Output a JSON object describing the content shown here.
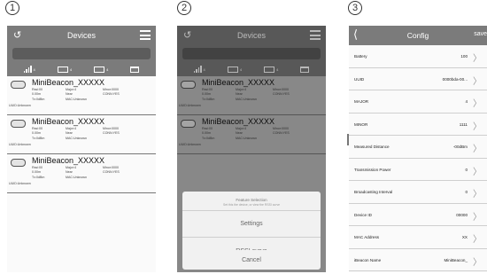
{
  "steps": [
    "1",
    "2",
    "3"
  ],
  "devices_screen": {
    "title": "Devices",
    "filters": [
      "4",
      "4",
      "4"
    ],
    "devices": [
      {
        "name": "MiniBeacon_XXXXX",
        "rssi": "Rssi:00",
        "distance": "0.00m",
        "tx": "Tx:0dBm",
        "major": "Major:4",
        "proximity": "Near",
        "mac": "MAC:Unknown",
        "minor": "Minor:0000",
        "conn": "CONN:YES",
        "uuid": "UUID:Unknown"
      },
      {
        "name": "MiniBeacon_XXXXX",
        "rssi": "Rssi:00",
        "distance": "0.00m",
        "tx": "Tx:0dBm",
        "major": "Major:4",
        "proximity": "Near",
        "mac": "MAC:Unknown",
        "minor": "Minor:0000",
        "conn": "CONN:YES",
        "uuid": "UUID:Unknown"
      },
      {
        "name": "MiniBeacon_XXXXX",
        "rssi": "Rssi:00",
        "distance": "0.00m",
        "tx": "Tx:0dBm",
        "major": "Major:4",
        "proximity": "Near",
        "mac": "MAC:Unknown",
        "minor": "Minor:0000",
        "conn": "CONN:YES",
        "uuid": "UUID:Unknown"
      }
    ]
  },
  "feature_sheet": {
    "title": "Feature Selection",
    "subtitle": "Set this the device, or view the RSSI curve",
    "settings_label": "Settings",
    "rssi_label": "RSSI curve",
    "cancel_label": "Cancel"
  },
  "config_screen": {
    "title": "Config",
    "save_label": "save",
    "rows": [
      {
        "label": "Battery",
        "value": "100"
      },
      {
        "label": "UUID",
        "value": "0000bda-00..."
      },
      {
        "label": "MAJOR",
        "value": "4"
      },
      {
        "label": "MINOR",
        "value": "1111"
      },
      {
        "label": "Measured Distance",
        "value": "-00dBm"
      },
      {
        "label": "Transmission Power",
        "value": "0"
      },
      {
        "label": "Broadcasting Interval",
        "value": "0"
      },
      {
        "label": "Device ID",
        "value": "00000"
      },
      {
        "label": "MAC Address",
        "value": "XX"
      },
      {
        "label": "iBeacon Name",
        "value": "MiniBeacon_"
      }
    ]
  }
}
